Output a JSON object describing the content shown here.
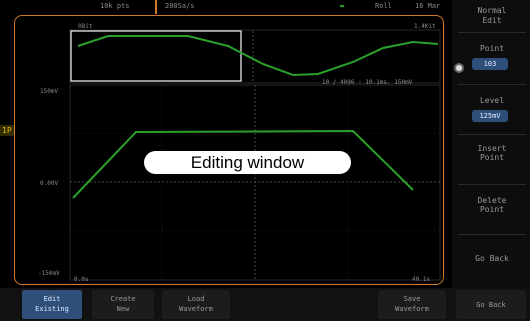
{
  "status": {
    "record_length": "10k pts",
    "sample_rate": "200Sa/s",
    "mode": "Roll",
    "date": "16 Mar",
    "channel_icon": "ac-source-icon"
  },
  "overview": {
    "left_label": "0Bit",
    "right_label": "1.4Kit"
  },
  "edit_chart": {
    "top_left_label": "150mV",
    "top_right_label": "10 / 4096 : 10.1ms. 150mV",
    "mid_left_label": "0.00V",
    "bottom_left_label": "-150mV",
    "bottom_x_left": "0.0s",
    "bottom_x_right": "40.1s"
  },
  "callout": {
    "text": "Editing window"
  },
  "right_panel": {
    "title_line1": "Normal",
    "title_line2": "Edit",
    "point_label": "Point",
    "point_value": "103",
    "level_label": "Level",
    "level_value": "125mV",
    "insert_label": "Insert",
    "insert_sub": "Point",
    "delete_label": "Delete",
    "delete_sub": "Point",
    "go_back": "Go Back"
  },
  "bottom_bar": {
    "edit_existing_1": "Edit",
    "edit_existing_2": "Existing",
    "create_new_1": "Create",
    "create_new_2": "New",
    "load_waveform_1": "Load",
    "load_waveform_2": "Waveform",
    "save_waveform_1": "Save",
    "save_waveform_2": "Waveform",
    "go_back": "Go Back"
  },
  "channel_marker": "1P",
  "colors": {
    "waveform": "#2aa02a",
    "frame": "#d07a2a",
    "highlight": "#2e4f7a"
  }
}
